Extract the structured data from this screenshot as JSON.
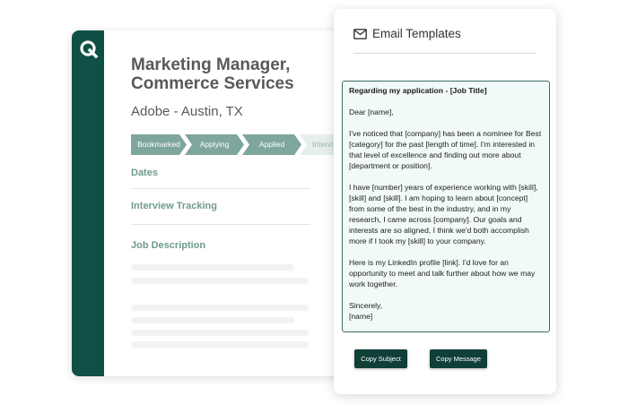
{
  "job": {
    "title_line1": "Marketing Manager,",
    "title_line2": "Commerce Services",
    "company_location": "Adobe - Austin, TX",
    "stages": [
      "Bookmarked",
      "Applying",
      "Applied",
      "Intervi"
    ],
    "sections": {
      "dates": "Dates",
      "interview_tracking": "Interview Tracking",
      "job_description": "Job Description"
    }
  },
  "email_panel": {
    "title": "Email Templates",
    "icon": "envelope-icon",
    "template": {
      "subject": "Regarding my application - [Job Title]",
      "greeting": "Dear [name],",
      "paragraph1": "I've noticed that [company] has been a nominee for Best [category] for the past [length of time]. I'm interested in that level of excellence and finding out more about [department or position].",
      "paragraph2": "I have [number] years of experience working with [skill], [skill] and [skill]. I am hoping to learn about [concept] from some of the best in the industry, and in my research, I came across [company]. Our goals and interests are so aligned, I think we'd both accomplish more if I took my [skill] to your company.",
      "paragraph3": "Here is my LinkedIn profile [link]. I'd love for an opportunity to meet and talk further about how we may work together.",
      "closing": "Sincerely,",
      "signature": "[name]"
    },
    "buttons": {
      "copy_subject": "Copy Subject",
      "copy_message": "Copy Message"
    }
  },
  "colors": {
    "brand_dark": "#0f4f45",
    "stage_fill": "#7ea69d",
    "section_text": "#6f9a91",
    "template_bg": "#f1faf9",
    "button_bg": "#0f3f37"
  }
}
